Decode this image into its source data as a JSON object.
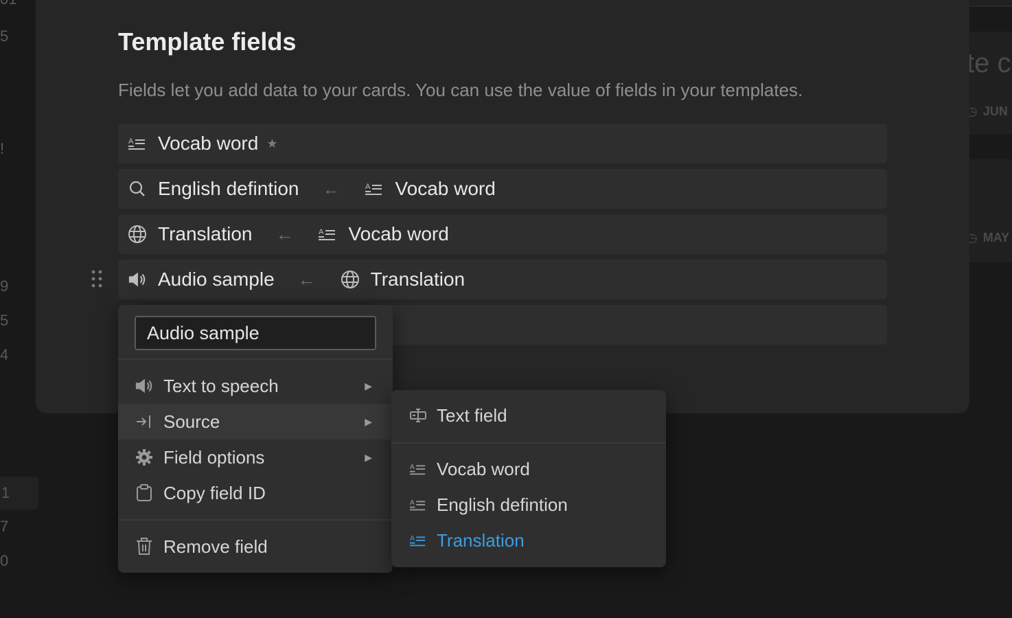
{
  "background": {
    "left_numbers": [
      "01",
      "5",
      "!",
      "9",
      "5",
      "4",
      "1",
      "7",
      "0"
    ],
    "right_title": "te c",
    "right_dates": [
      "JUN",
      "MAY"
    ]
  },
  "modal": {
    "title": "Template fields",
    "description": "Fields let you add data to your cards. You can use the value of fields in your templates."
  },
  "fields": [
    {
      "name": "Vocab word",
      "icon": "text-lines-icon",
      "primary": true
    },
    {
      "name": "English defintion",
      "icon": "search-icon",
      "source": "Vocab word",
      "source_icon": "text-lines-icon"
    },
    {
      "name": "Translation",
      "icon": "globe-icon",
      "source": "Vocab word",
      "source_icon": "text-lines-icon"
    },
    {
      "name": "Audio sample",
      "icon": "speaker-icon",
      "source": "Translation",
      "source_icon": "globe-icon"
    }
  ],
  "context_menu": {
    "name_value": "Audio sample",
    "items": [
      {
        "label": "Text to speech",
        "icon": "speaker-icon",
        "has_submenu": true
      },
      {
        "label": "Source",
        "icon": "source-arrow-icon",
        "has_submenu": true,
        "active": true
      },
      {
        "label": "Field options",
        "icon": "gear-icon",
        "has_submenu": true
      },
      {
        "label": "Copy field ID",
        "icon": "clipboard-icon",
        "has_submenu": false
      }
    ],
    "remove_label": "Remove field"
  },
  "source_submenu": {
    "top_item": {
      "label": "Text field",
      "icon": "text-field-icon"
    },
    "items": [
      {
        "label": "Vocab word",
        "icon": "text-lines-icon",
        "selected": false
      },
      {
        "label": "English defintion",
        "icon": "text-lines-icon",
        "selected": false
      },
      {
        "label": "Translation",
        "icon": "text-lines-icon",
        "selected": true
      }
    ]
  },
  "colors": {
    "accent": "#3a9ee0",
    "modal_bg": "#262626",
    "page_bg": "#191919"
  }
}
